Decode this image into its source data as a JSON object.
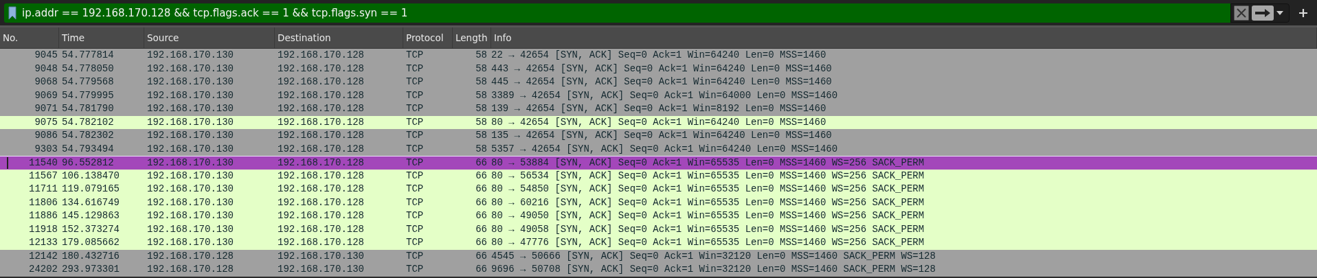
{
  "filter_bar": {
    "value": "ip.addr == 192.168.170.128 && tcp.flags.ack == 1 && tcp.flags.syn == 1",
    "valid": true
  },
  "table": {
    "columns": [
      "No.",
      "Time",
      "Source",
      "Destination",
      "Protocol",
      "Length",
      "Info"
    ],
    "rows": [
      {
        "no": "9045",
        "time": "54.777814",
        "source": "192.168.170.130",
        "destination": "192.168.170.128",
        "protocol": "TCP",
        "length": "58",
        "info": "22 → 42654 [SYN, ACK] Seq=0 Ack=1 Win=64240 Len=0 MSS=1460",
        "color": "#a0a0a0",
        "selected": false
      },
      {
        "no": "9048",
        "time": "54.778050",
        "source": "192.168.170.130",
        "destination": "192.168.170.128",
        "protocol": "TCP",
        "length": "58",
        "info": "443 → 42654 [SYN, ACK] Seq=0 Ack=1 Win=64240 Len=0 MSS=1460",
        "color": "#a0a0a0",
        "selected": false
      },
      {
        "no": "9068",
        "time": "54.779568",
        "source": "192.168.170.130",
        "destination": "192.168.170.128",
        "protocol": "TCP",
        "length": "58",
        "info": "445 → 42654 [SYN, ACK] Seq=0 Ack=1 Win=64240 Len=0 MSS=1460",
        "color": "#a0a0a0",
        "selected": false
      },
      {
        "no": "9069",
        "time": "54.779995",
        "source": "192.168.170.130",
        "destination": "192.168.170.128",
        "protocol": "TCP",
        "length": "58",
        "info": "3389 → 42654 [SYN, ACK] Seq=0 Ack=1 Win=64000 Len=0 MSS=1460",
        "color": "#a0a0a0",
        "selected": false
      },
      {
        "no": "9071",
        "time": "54.781790",
        "source": "192.168.170.130",
        "destination": "192.168.170.128",
        "protocol": "TCP",
        "length": "58",
        "info": "139 → 42654 [SYN, ACK] Seq=0 Ack=1 Win=8192 Len=0 MSS=1460",
        "color": "#a0a0a0",
        "selected": false
      },
      {
        "no": "9075",
        "time": "54.782102",
        "source": "192.168.170.130",
        "destination": "192.168.170.128",
        "protocol": "TCP",
        "length": "58",
        "info": "80 → 42654 [SYN, ACK] Seq=0 Ack=1 Win=64240 Len=0 MSS=1460",
        "color": "#e4ffc7",
        "selected": false
      },
      {
        "no": "9086",
        "time": "54.782302",
        "source": "192.168.170.130",
        "destination": "192.168.170.128",
        "protocol": "TCP",
        "length": "58",
        "info": "135 → 42654 [SYN, ACK] Seq=0 Ack=1 Win=64240 Len=0 MSS=1460",
        "color": "#a0a0a0",
        "selected": false
      },
      {
        "no": "9303",
        "time": "54.793494",
        "source": "192.168.170.130",
        "destination": "192.168.170.128",
        "protocol": "TCP",
        "length": "58",
        "info": "5357 → 42654 [SYN, ACK] Seq=0 Ack=1 Win=64240 Len=0 MSS=1460",
        "color": "#a0a0a0",
        "selected": false
      },
      {
        "no": "11540",
        "time": "96.552812",
        "source": "192.168.170.130",
        "destination": "192.168.170.128",
        "protocol": "TCP",
        "length": "66",
        "info": "80 → 53884 [SYN, ACK] Seq=0 Ack=1 Win=65535 Len=0 MSS=1460 WS=256 SACK_PERM",
        "selected": true
      },
      {
        "no": "11567",
        "time": "106.138470",
        "source": "192.168.170.130",
        "destination": "192.168.170.128",
        "protocol": "TCP",
        "length": "66",
        "info": "80 → 56534 [SYN, ACK] Seq=0 Ack=1 Win=65535 Len=0 MSS=1460 WS=256 SACK_PERM",
        "color": "#e4ffc7",
        "selected": false
      },
      {
        "no": "11711",
        "time": "119.079165",
        "source": "192.168.170.130",
        "destination": "192.168.170.128",
        "protocol": "TCP",
        "length": "66",
        "info": "80 → 54850 [SYN, ACK] Seq=0 Ack=1 Win=65535 Len=0 MSS=1460 WS=256 SACK_PERM",
        "color": "#e4ffc7",
        "selected": false
      },
      {
        "no": "11806",
        "time": "134.616749",
        "source": "192.168.170.130",
        "destination": "192.168.170.128",
        "protocol": "TCP",
        "length": "66",
        "info": "80 → 60216 [SYN, ACK] Seq=0 Ack=1 Win=65535 Len=0 MSS=1460 WS=256 SACK_PERM",
        "color": "#e4ffc7",
        "selected": false
      },
      {
        "no": "11886",
        "time": "145.129863",
        "source": "192.168.170.130",
        "destination": "192.168.170.128",
        "protocol": "TCP",
        "length": "66",
        "info": "80 → 49050 [SYN, ACK] Seq=0 Ack=1 Win=65535 Len=0 MSS=1460 WS=256 SACK_PERM",
        "color": "#e4ffc7",
        "selected": false
      },
      {
        "no": "11918",
        "time": "152.373274",
        "source": "192.168.170.130",
        "destination": "192.168.170.128",
        "protocol": "TCP",
        "length": "66",
        "info": "80 → 49058 [SYN, ACK] Seq=0 Ack=1 Win=65535 Len=0 MSS=1460 WS=256 SACK_PERM",
        "color": "#e4ffc7",
        "selected": false
      },
      {
        "no": "12133",
        "time": "179.085662",
        "source": "192.168.170.130",
        "destination": "192.168.170.128",
        "protocol": "TCP",
        "length": "66",
        "info": "80 → 47776 [SYN, ACK] Seq=0 Ack=1 Win=65535 Len=0 MSS=1460 WS=256 SACK_PERM",
        "color": "#e4ffc7",
        "selected": false
      },
      {
        "no": "12142",
        "time": "180.432716",
        "source": "192.168.170.128",
        "destination": "192.168.170.130",
        "protocol": "TCP",
        "length": "66",
        "info": "4545 → 50666 [SYN, ACK] Seq=0 Ack=1 Win=32120 Len=0 MSS=1460 SACK_PERM WS=128",
        "color": "#a0a0a0",
        "selected": false
      },
      {
        "no": "24202",
        "time": "293.973301",
        "source": "192.168.170.128",
        "destination": "192.168.170.130",
        "protocol": "TCP",
        "length": "66",
        "info": "9696 → 50708 [SYN, ACK] Seq=0 Ack=1 Win=32120 Len=0 MSS=1460 SACK_PERM WS=128",
        "color": "#a0a0a0",
        "selected": false
      }
    ]
  }
}
